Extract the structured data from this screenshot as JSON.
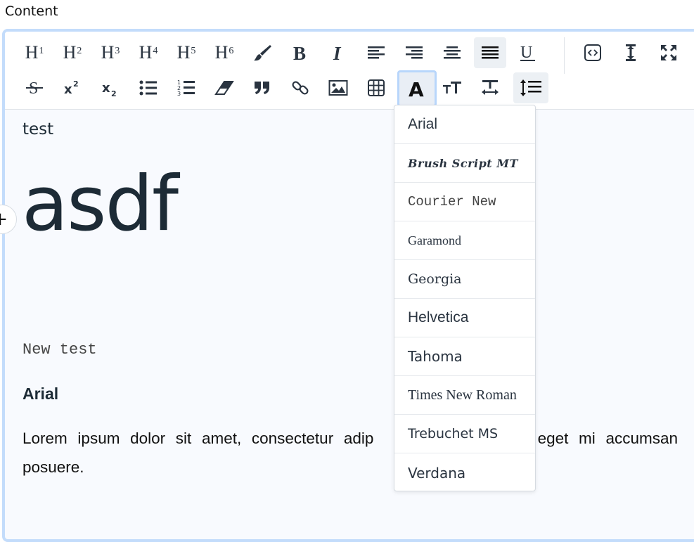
{
  "field": {
    "label": "Content"
  },
  "toolbar": {
    "headings": [
      {
        "letter": "H",
        "level": "1"
      },
      {
        "letter": "H",
        "level": "2"
      },
      {
        "letter": "H",
        "level": "3"
      },
      {
        "letter": "H",
        "level": "4"
      },
      {
        "letter": "H",
        "level": "5"
      },
      {
        "letter": "H",
        "level": "6"
      }
    ],
    "font_button_glyph": "A"
  },
  "document": {
    "line1": "test",
    "heading": "asdf",
    "code_line": "New test",
    "bold_line": "Arial",
    "paragraph_before": "Lorem ipsum dolor sit amet, consectetur adip",
    "paragraph_after": "ollicitudin eget mi accumsan posuere."
  },
  "plus_handle": {
    "glyph": "+"
  },
  "font_dropdown": {
    "options": [
      "Arial",
      "Brush Script MT",
      "Courier New",
      "Garamond",
      "Georgia",
      "Helvetica",
      "Tahoma",
      "Times New Roman",
      "Trebuchet MS",
      "Verdana"
    ]
  },
  "colors": {
    "focus_border": "#c3dcfb",
    "text": "#1d2b36",
    "toolbar_active": "#ecf0f4"
  }
}
